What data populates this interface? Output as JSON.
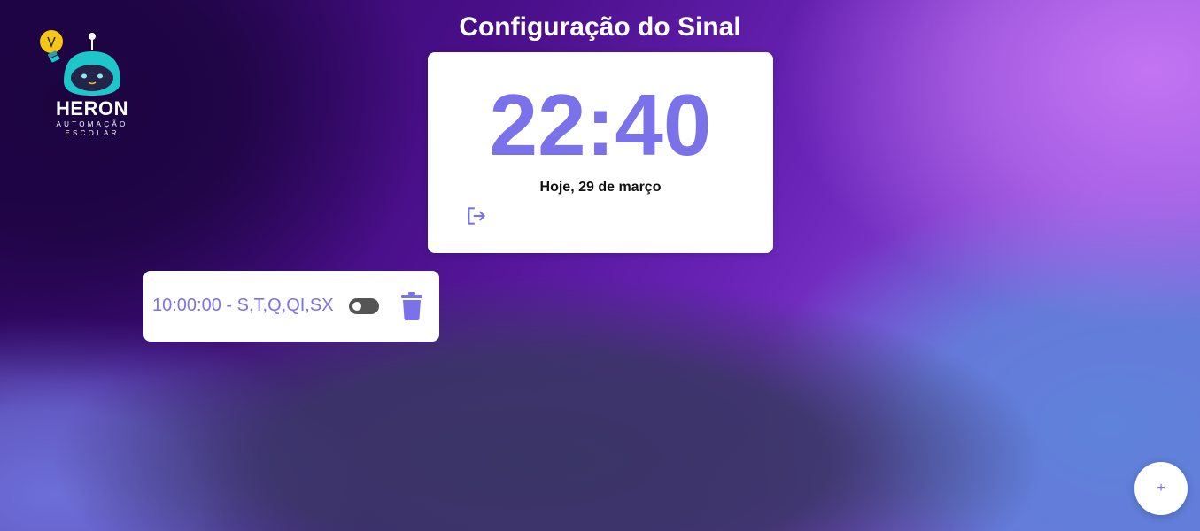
{
  "logo": {
    "title": "HERON",
    "subtitle_line1": "AUTOMAÇÃO",
    "subtitle_line2": "ESCOLAR",
    "icon": "robot-mascot-icon",
    "colors": {
      "robot": "#1ec6c9",
      "bulb": "#f5c518"
    }
  },
  "page": {
    "title": "Configuração do Sinal"
  },
  "clock": {
    "time": "22:40",
    "date": "Hoje, 29 de março",
    "logout_icon": "logout-icon"
  },
  "schedules": [
    {
      "label": "10:00:00 - S,T,Q,QI,SX",
      "enabled": false,
      "delete_icon": "trash-icon"
    }
  ],
  "fab": {
    "label": "+"
  },
  "colors": {
    "accent": "#7b72ea",
    "card": "#ffffff",
    "toggle_off": "#555555"
  }
}
